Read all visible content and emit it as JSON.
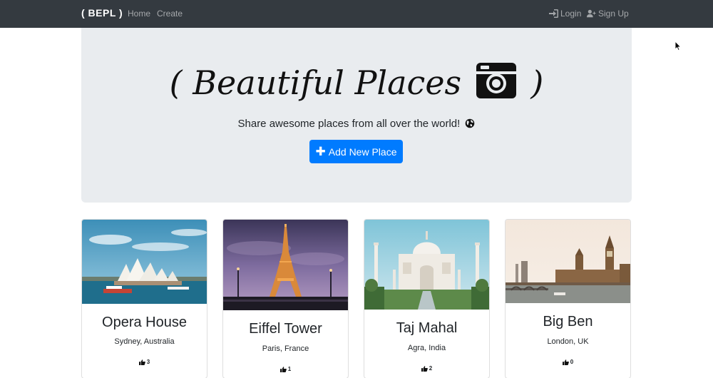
{
  "navbar": {
    "brand": "( BEPL )",
    "links": [
      "Home",
      "Create"
    ],
    "login_label": "Login",
    "signup_label": "Sign Up"
  },
  "hero": {
    "title_left": "( Beautiful Places",
    "title_right": ")",
    "subtitle": "Share awesome places from all over the world!",
    "button_label": "Add New Place"
  },
  "places": [
    {
      "name": "Opera House",
      "location": "Sydney, Australia",
      "likes": "3"
    },
    {
      "name": "Eiffel Tower",
      "location": "Paris, France",
      "likes": "1"
    },
    {
      "name": "Taj Mahal",
      "location": "Agra, India",
      "likes": "2"
    },
    {
      "name": "Big Ben",
      "location": "London, UK",
      "likes": "0"
    }
  ],
  "colors": {
    "navbar_bg": "#343a40",
    "jumbotron_bg": "#e9ecef",
    "primary": "#007bff"
  },
  "icons": {
    "login": "sign-in-icon",
    "signup": "user-plus-icon",
    "camera": "camera-icon",
    "globe": "globe-icon",
    "add": "plus-icon",
    "like": "thumbs-up-icon"
  }
}
